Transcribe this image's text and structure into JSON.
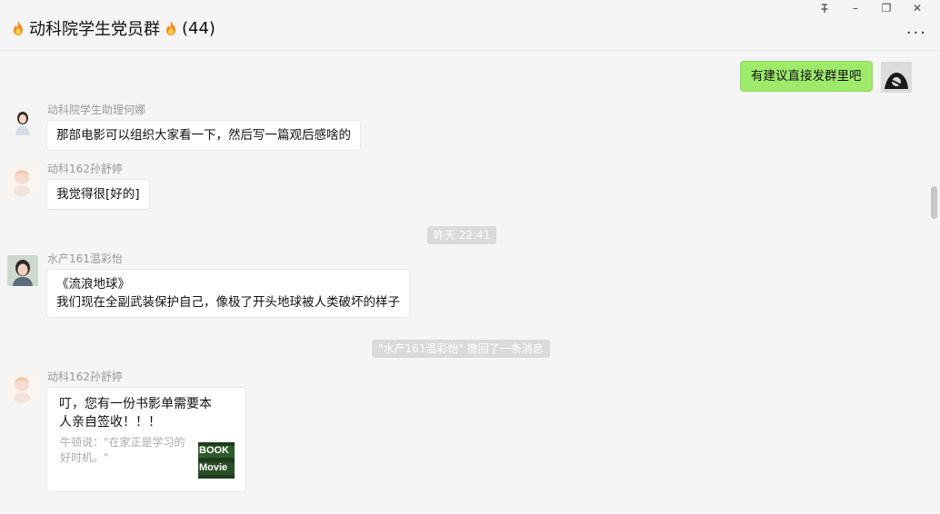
{
  "header": {
    "title": "动科院学生党员群",
    "count": "(44)",
    "pin_icon": "pin-icon",
    "minimize_label": "–",
    "maximize_label": "❐",
    "close_label": "✕",
    "more_label": "···"
  },
  "messages": {
    "m1": {
      "text": "有建议直接发群里吧"
    },
    "m2": {
      "sender": "动科院学生助理何娜",
      "text": "那部电影可以组织大家看一下，然后写一篇观后感啥的"
    },
    "m3": {
      "sender": "动科162孙舒婷",
      "text": "我觉得很[好的]"
    },
    "time1": "昨天 22:41",
    "m4": {
      "sender": "水产161温彩怡",
      "line1": "《流浪地球》",
      "line2": "我们现在全副武装保护自己，像极了开头地球被人类破坏的样子"
    },
    "recall": "\"水产161温彩怡\" 撤回了一条消息",
    "m5": {
      "sender": "动科162孙舒婷",
      "card_title": "叮，您有一份书影单需要本人亲自签收！！！",
      "card_desc": "牛顿说：\"在家正是学习的好时机。\"",
      "thumb_top": "BOOK",
      "thumb_bottom": "Movie"
    }
  },
  "colors": {
    "my_bubble": "#9eea6a",
    "notice_bg": "#dadada"
  }
}
